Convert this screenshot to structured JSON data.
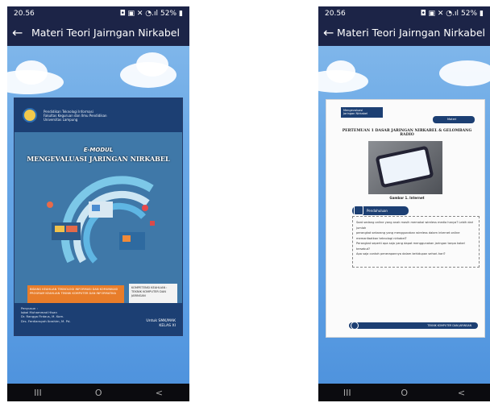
{
  "left": {
    "status": {
      "time": "20.56",
      "icons": "◘ ▣ ✕ ◔.ıl",
      "battery": "52%"
    },
    "appbar": {
      "back": "←",
      "title": "Materi Teori Jairngan Nirkabel"
    },
    "cover": {
      "institution": [
        "Pendidikan Teknologi Informasi",
        "Fakultas Keguruan dan Ilmu Pendidikan",
        "Universitas Lampung"
      ],
      "subtitle": "E-MODUL",
      "title": "MENGEVALUASI JARINGAN NIRKABEL",
      "orange_text": [
        "BIDANG KEAHLIAN TEKNOLOGI INFORMASI DAN KOMUNIKASI",
        "PROGRAM KEAHLIAN TEKNIK KOMPUTER DAN INFORMATIKA"
      ],
      "kompetensi": [
        "KOMPETENSI KEAHLIAN :",
        "TEKNIK KOMPUTER DAN",
        "JARINGAN"
      ],
      "authors_label": "Penyusun :",
      "authors": [
        "Iqbal Muhammad Hisan",
        "Dr. Rangga Firdaus, M. Kom.",
        "Drs. Ferdiansyah Ibrahim, M. Pd."
      ],
      "for_label": "Untuk SMK/MAK",
      "class_label": "KELAS XI"
    },
    "nav": {
      "recent": "III",
      "home": "O",
      "back": "<"
    }
  },
  "right": {
    "status": {
      "time": "20.56",
      "icons": "◘ ▣ ✕ ◔.ıl",
      "battery": "52%"
    },
    "appbar": {
      "back": "←",
      "title": "Materi Teori Jairngan Nirkabel"
    },
    "page": {
      "tag": [
        "Mengevaluasi",
        "Jaringan Nirkabel"
      ],
      "materi": "Materi",
      "heading": "PERTEMUAN 1 DASAR JARINGAN NIRKABEL & GELOMBANG RADIO",
      "photo_caption": "Gambar 1. Internet",
      "pendahuluan": "Pendahuluan",
      "paragraph": [
        "Saat sedang online yang anak masih memakai wireless media hanya? Lebih dari jumlah",
        "perangkat sekarang yang menggunakan wireless dalam internet online",
        "memanfaatkan teknologi nirkabel?",
        "Perangkat seperti apa saja yang dapat menggunakan jaringan tanpa kabel",
        "tersebut?",
        "Apa saja contoh penerapannya dalam kehidupan sehari-hari?"
      ],
      "footer": "TEKNIK KOMPUTER DAN JARINGAN"
    },
    "nav": {
      "recent": "III",
      "home": "O",
      "back": "<"
    }
  },
  "colors": {
    "appbar": "#1c2447",
    "sky": "#5d9fe4",
    "cover": "#3f78a8",
    "navy": "#1c3f73",
    "orange": "#e87d2a"
  }
}
